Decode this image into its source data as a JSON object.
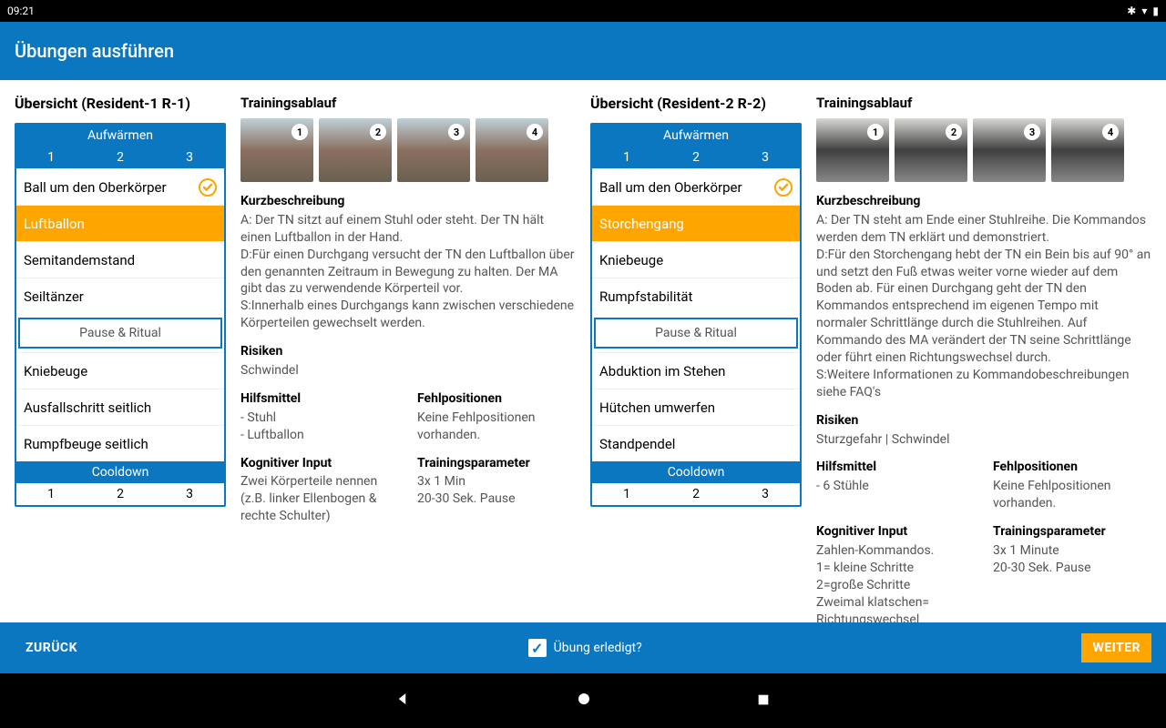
{
  "status": {
    "time": "09:21"
  },
  "header": {
    "title": "Übungen ausführen"
  },
  "left": {
    "overview_title": "Übersicht (Resident-1 R-1)",
    "warmup_label": "Aufwärmen",
    "warmup_nums": [
      "1",
      "2",
      "3"
    ],
    "exercises": [
      {
        "name": "Ball um den Oberkörper",
        "checked": true
      },
      {
        "name": "Luftballon",
        "selected": true
      },
      {
        "name": "Semitandemstand"
      },
      {
        "name": "Seiltänzer"
      }
    ],
    "pause_label": "Pause & Ritual",
    "exercises_after": [
      {
        "name": "Kniebeuge"
      },
      {
        "name": "Ausfallschritt seitlich"
      },
      {
        "name": "Rumpfbeuge seitlich"
      }
    ],
    "cooldown_label": "Cooldown",
    "cooldown_nums": [
      "1",
      "2",
      "3"
    ],
    "training_title": "Trainingsablauf",
    "thumb_nums": [
      "1",
      "2",
      "3",
      "4"
    ],
    "kurz_h": "Kurzbeschreibung",
    "kurz_body": "A: Der TN sitzt auf einem Stuhl oder steht. Der TN hält einen Luftballon in der Hand.\nD:Für einen Durchgang versucht der TN den Luftballon über den genannten Zeitraum in Bewegung zu halten. Der MA gibt das zu verwendende Körperteil vor.\nS:Innerhalb eines Durchgangs kann zwischen verschiedene Körperteilen gewechselt werden.",
    "risiken_h": "Risiken",
    "risiken_body": "Schwindel",
    "hilf_h": "Hilfsmittel",
    "hilf_body": "- Stuhl\n- Luftballon",
    "fehl_h": "Fehlpositionen",
    "fehl_body": "Keine Fehlpositionen vorhanden.",
    "kog_h": "Kognitiver Input",
    "kog_body": "Zwei Körperteile nennen (z.B. linker Ellenbogen & rechte Schulter)",
    "param_h": "Trainingsparameter",
    "param_body": "3x 1 Min\n20-30 Sek. Pause"
  },
  "right": {
    "overview_title": "Übersicht (Resident-2 R-2)",
    "warmup_label": "Aufwärmen",
    "warmup_nums": [
      "1",
      "2",
      "3"
    ],
    "exercises": [
      {
        "name": "Ball um den Oberkörper",
        "checked": true
      },
      {
        "name": "Storchengang",
        "selected": true
      },
      {
        "name": "Kniebeuge"
      },
      {
        "name": "Rumpfstabilität"
      }
    ],
    "pause_label": "Pause & Ritual",
    "exercises_after": [
      {
        "name": "Abduktion im Stehen"
      },
      {
        "name": "Hütchen umwerfen"
      },
      {
        "name": "Standpendel"
      }
    ],
    "cooldown_label": "Cooldown",
    "cooldown_nums": [
      "1",
      "2",
      "3"
    ],
    "training_title": "Trainingsablauf",
    "thumb_nums": [
      "1",
      "2",
      "3",
      "4"
    ],
    "kurz_h": "Kurzbeschreibung",
    "kurz_body": "A: Der TN steht am Ende einer Stuhlreihe. Die Kommandos werden dem TN erklärt und demonstriert.\nD:Für den Storchengang hebt der TN ein Bein bis auf 90° an und setzt den Fuß etwas weiter vorne wieder auf dem Boden ab. Für einen Durchgang geht der TN den Kommandos entsprechend im eigenen Tempo mit normaler Schrittlänge durch die Stuhlreihen. Auf Kommando des MA verändert der TN seine Schrittlänge oder führt einen Richtungswechsel durch.\nS:Weitere Informationen zu Kommandobeschreibungen siehe FAQ's",
    "risiken_h": "Risiken",
    "risiken_body": "Sturzgefahr | Schwindel",
    "hilf_h": "Hilfsmittel",
    "hilf_body": "- 6 Stühle",
    "fehl_h": "Fehlpositionen",
    "fehl_body": "Keine Fehlpositionen vorhanden.",
    "kog_h": "Kognitiver Input",
    "kog_body": "Zahlen-Kommandos.\n1= kleine Schritte\n2=große Schritte\nZweimal klatschen= Richtungswechsel",
    "param_h": "Trainingsparameter",
    "param_body": "3x 1 Minute\n20-30 Sek. Pause"
  },
  "bottom": {
    "back": "ZURÜCK",
    "done_label": "Übung erledigt?",
    "next": "WEITER"
  }
}
